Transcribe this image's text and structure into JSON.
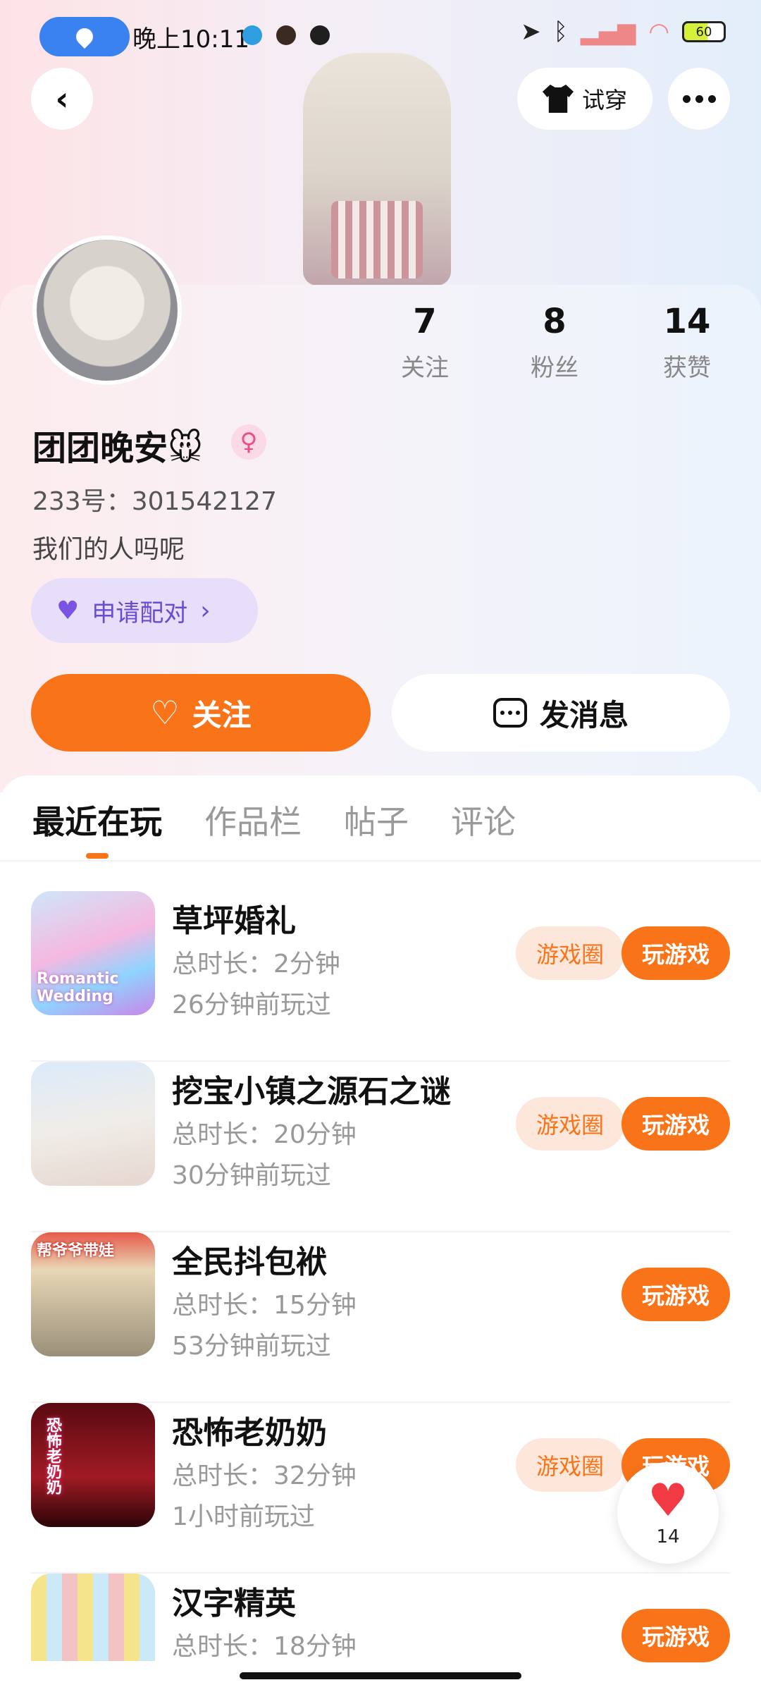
{
  "status_bar": {
    "time": "晚上10:11",
    "battery": "60"
  },
  "header": {
    "try_on_label": "试穿"
  },
  "profile": {
    "nickname": "团团晚安🐭",
    "gender_symbol": "♀",
    "uid": "233号：301542127",
    "bio": "我们的人吗呢",
    "pair_label": "申请配对",
    "stats": [
      {
        "value": "7",
        "label": "关注"
      },
      {
        "value": "8",
        "label": "粉丝"
      },
      {
        "value": "14",
        "label": "获赞"
      }
    ],
    "follow_label": "关注",
    "message_label": "发消息"
  },
  "tabs": [
    {
      "label": "最近在玩",
      "active": true
    },
    {
      "label": "作品栏",
      "active": false
    },
    {
      "label": "帖子",
      "active": false
    },
    {
      "label": "评论",
      "active": false
    }
  ],
  "games": [
    {
      "name": "草坪婚礼",
      "duration": "总时长：2分钟",
      "last_played": "26分钟前玩过",
      "circle_label": "游戏圈",
      "play_label": "玩游戏",
      "thumb_text": "Romantic Wedding"
    },
    {
      "name": "挖宝小镇之源石之谜",
      "duration": "总时长：20分钟",
      "last_played": "30分钟前玩过",
      "circle_label": "游戏圈",
      "play_label": "玩游戏",
      "thumb_text": ""
    },
    {
      "name": "全民抖包袱",
      "duration": "总时长：15分钟",
      "last_played": "53分钟前玩过",
      "circle_label": "",
      "play_label": "玩游戏",
      "thumb_text": "帮爷爷带娃"
    },
    {
      "name": "恐怖老奶奶",
      "duration": "总时长：32分钟",
      "last_played": "1小时前玩过",
      "circle_label": "游戏圈",
      "play_label": "玩游戏",
      "thumb_text": "恐怖老奶奶"
    },
    {
      "name": "汉字精英",
      "duration": "总时长：18分钟",
      "last_played": "",
      "circle_label": "",
      "play_label": "玩游戏",
      "thumb_text": ""
    }
  ],
  "like_fab": {
    "count": "14"
  },
  "colors": {
    "accent": "#f97419",
    "pair_purple": "#7a52e4",
    "like_red": "#f23a44"
  }
}
